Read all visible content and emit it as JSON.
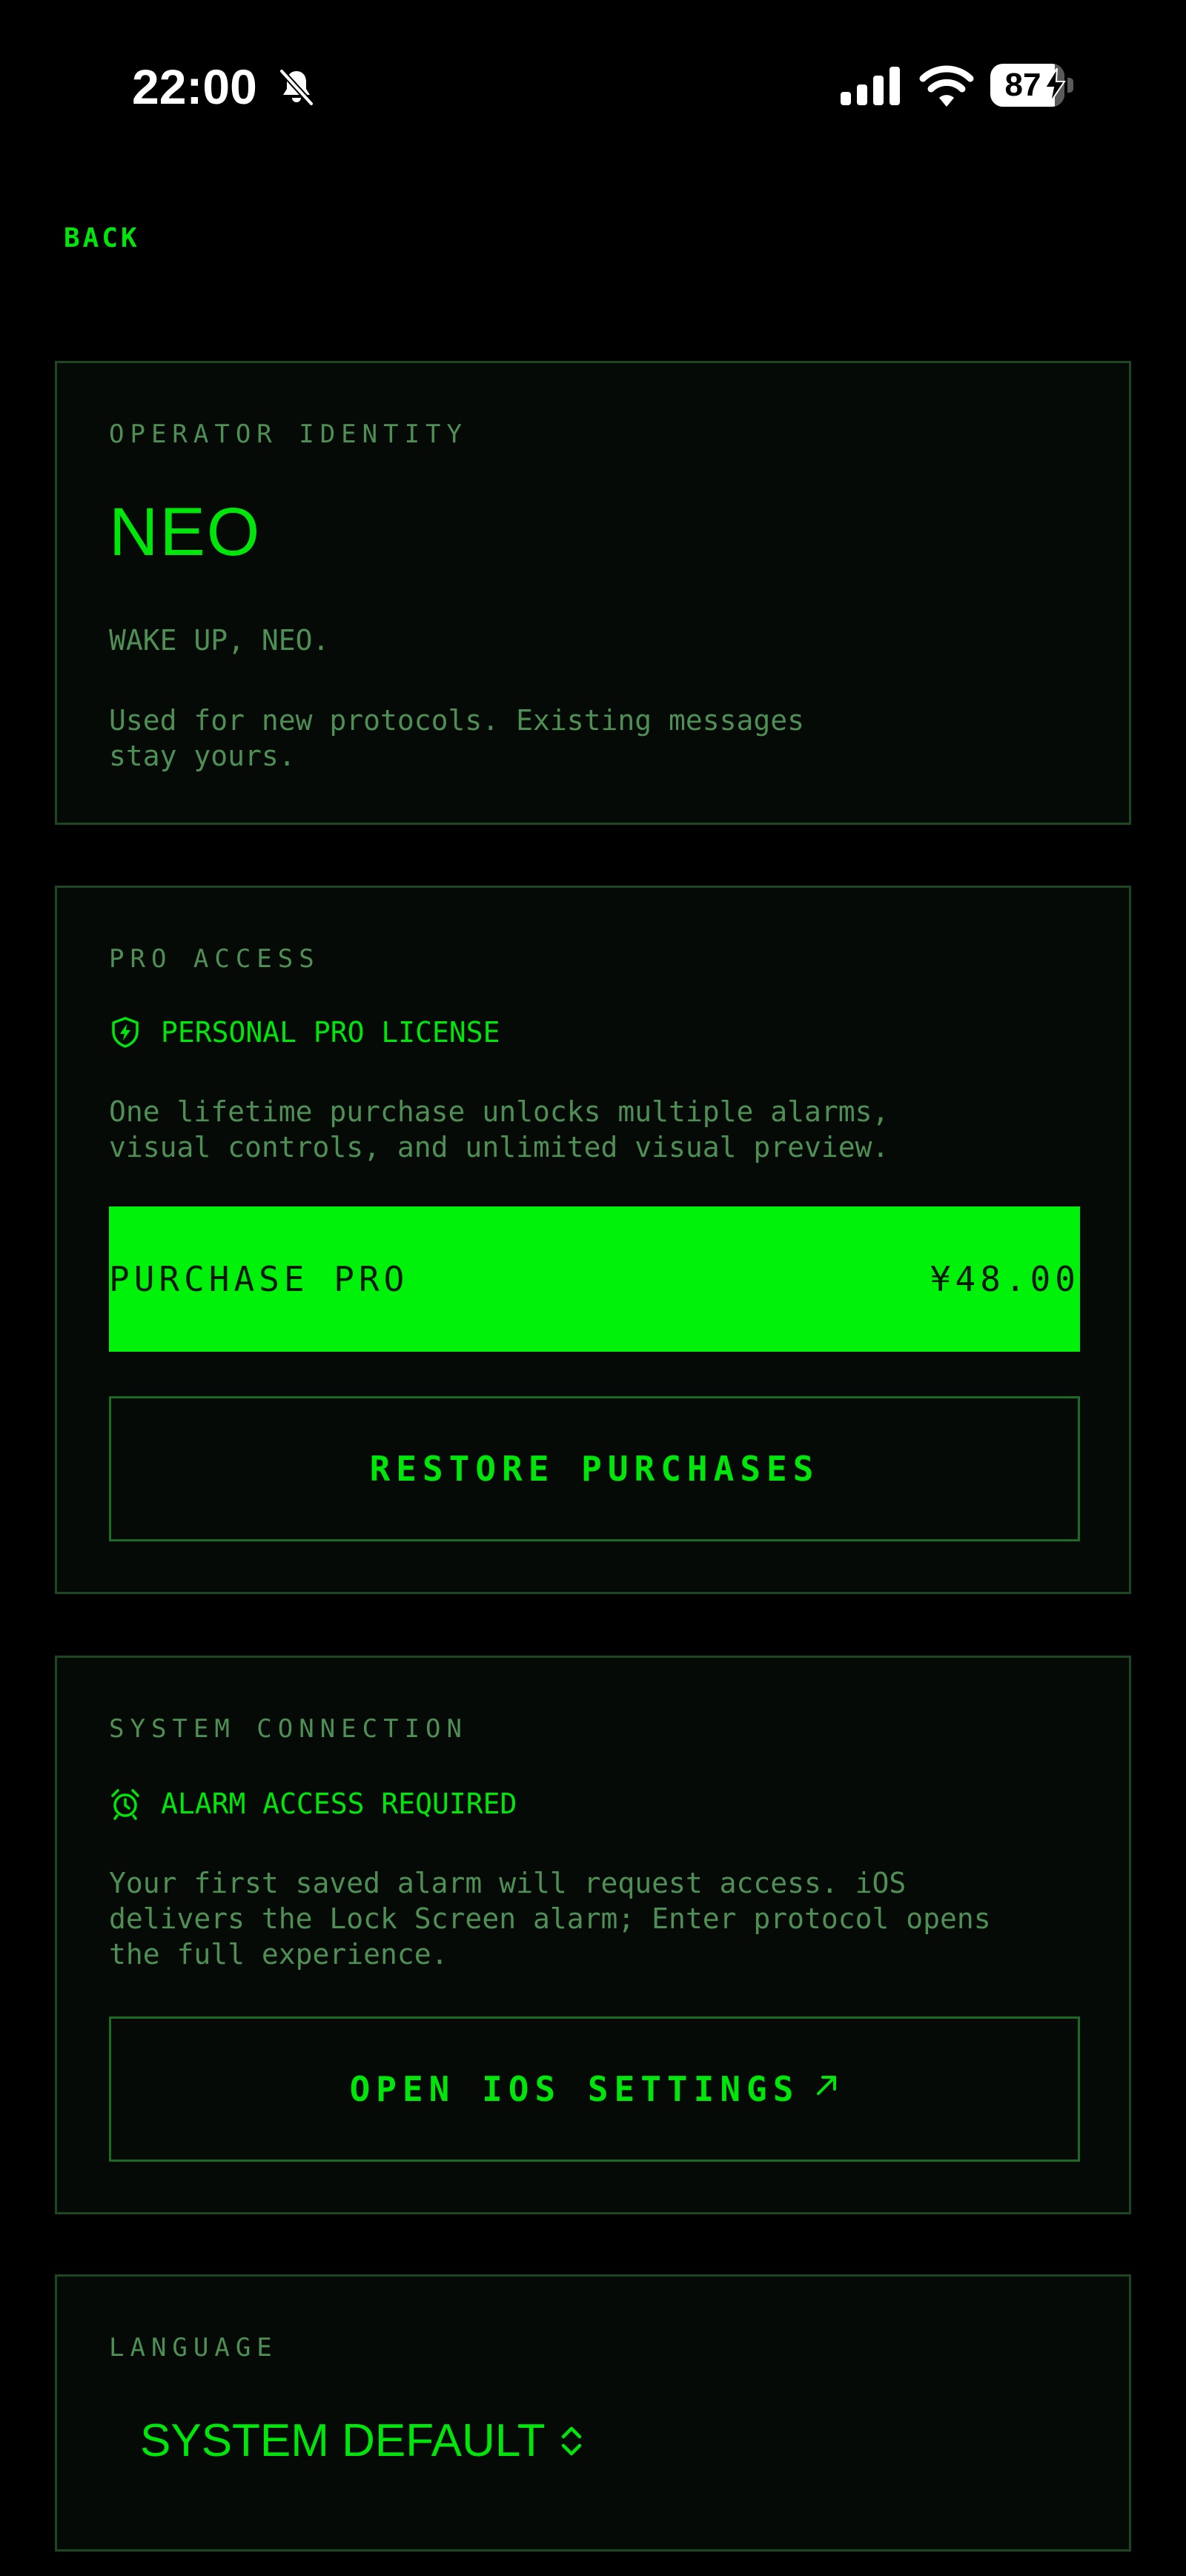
{
  "status_bar": {
    "time": "22:00",
    "battery_percent": "87",
    "battery_level": 0.87,
    "icons": [
      "bell-off-icon",
      "signal-icon",
      "wifi-icon",
      "battery-icon",
      "bolt-icon"
    ]
  },
  "nav": {
    "back_label": "BACK"
  },
  "identity": {
    "section_label": "OPERATOR IDENTITY",
    "name": "NEO",
    "greeting": "WAKE UP, NEO.",
    "description": "Used for new protocols. Existing messages\nstay yours."
  },
  "pro_access": {
    "section_label": "PRO ACCESS",
    "license_icon": "shield-bolt-icon",
    "license_label": "PERSONAL PRO LICENSE",
    "description": "One lifetime purchase unlocks multiple alarms,\nvisual controls, and unlimited visual preview.",
    "purchase_label": "PURCHASE PRO",
    "purchase_price": "¥48.00",
    "restore_label": "RESTORE PURCHASES"
  },
  "system_connection": {
    "section_label": "SYSTEM CONNECTION",
    "alarm_icon": "alarm-clock-icon",
    "alarm_label": "ALARM ACCESS REQUIRED",
    "description": "Your first saved alarm will request access. iOS\ndelivers the Lock Screen alarm; Enter protocol opens\nthe full experience.",
    "settings_label": "OPEN IOS SETTINGS",
    "settings_icon": "arrow-up-right-icon"
  },
  "language": {
    "section_label": "LANGUAGE",
    "selected": "SYSTEM DEFAULT",
    "select_icon": "chevron-up-down-icon"
  },
  "colors": {
    "background": "#000000",
    "card_background": "#050a06",
    "card_border": "#1c4722",
    "accent": "#00e60a",
    "accent_bright": "#00f20a",
    "muted": "#4f8f56"
  }
}
